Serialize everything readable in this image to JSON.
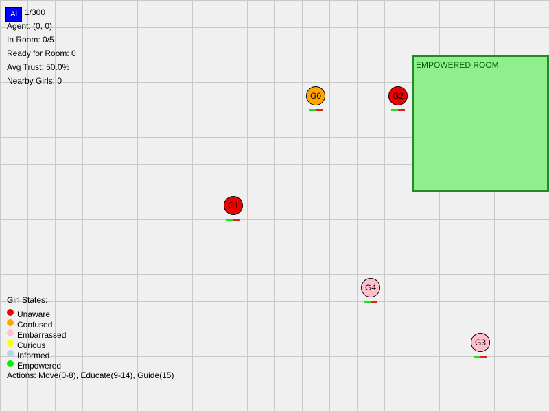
{
  "agent": {
    "label": "Ai",
    "color": "#0000ff"
  },
  "hud": {
    "step": "1/300",
    "agent_pos": "Agent: (0, 0)",
    "in_room": "In Room: 0/5",
    "ready": "Ready for Room: 0",
    "avg_trust": "Avg Trust: 50.0%",
    "nearby": "Nearby Girls: 0"
  },
  "room": {
    "label": "EMPOWERED ROOM",
    "fill": "#90ee90",
    "border": "#228b22"
  },
  "girls": [
    {
      "label": "G0",
      "state": "Confused",
      "color": "#ffa500",
      "trust": 0.5
    },
    {
      "label": "G1",
      "state": "Unaware",
      "color": "#ee0000",
      "trust": 0.5
    },
    {
      "label": "G2",
      "state": "Unaware",
      "color": "#ee0000",
      "trust": 0.5
    },
    {
      "label": "G3",
      "state": "Embarrassed",
      "color": "#ffc0cb",
      "trust": 0.5
    },
    {
      "label": "G4",
      "state": "Embarrassed",
      "color": "#ffc0cb",
      "trust": 0.5
    }
  ],
  "legend": {
    "title": "Girl States:",
    "items": [
      {
        "label": "Unaware",
        "color": "#ee0000"
      },
      {
        "label": "Confused",
        "color": "#ffa500"
      },
      {
        "label": "Embarrassed",
        "color": "#ffc0cb"
      },
      {
        "label": "Curious",
        "color": "#ffff00"
      },
      {
        "label": "Informed",
        "color": "#add8e6"
      },
      {
        "label": "Empowered",
        "color": "#00ee00"
      }
    ]
  },
  "actions": "Actions: Move(0-8), Educate(9-14), Guide(15)"
}
